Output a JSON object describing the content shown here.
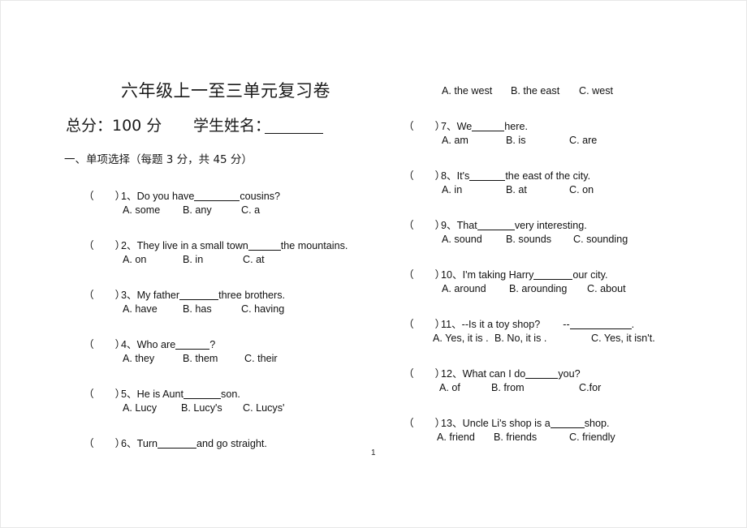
{
  "document": {
    "title": "六年级上一至三单元复习卷",
    "total_score_label": "总分：100 分",
    "student_name_label": "学生姓名：",
    "section_heading": "一、单项选择（每题 3 分，共 45 分）",
    "page_number": "1",
    "open_paren": "（",
    "close_paren": "）"
  },
  "left_column": {
    "questions": [
      {
        "number": "1、",
        "text_before": "Do you have",
        "text_after": "cousins?",
        "options": [
          "A. some",
          "B. any",
          "C. a"
        ]
      },
      {
        "number": "2、",
        "text_before": "They live in a small town",
        "text_after": "the mountains.",
        "options": [
          "A. on",
          "B. in",
          "C. at"
        ]
      },
      {
        "number": "3、",
        "text_before": "My father",
        "text_after": "three brothers.",
        "options": [
          "A. have",
          "B. has",
          "C. having"
        ]
      },
      {
        "number": "4、",
        "text_before": "Who are",
        "text_after": "?",
        "options": [
          "A. they",
          "B. them",
          "C. their"
        ]
      },
      {
        "number": "5、",
        "text_before": "He is Aunt",
        "text_after": "son.",
        "options": [
          "A. Lucy",
          "B. Lucy's",
          "C. Lucys'"
        ]
      },
      {
        "number": "6、",
        "text_before": "Turn",
        "text_after": "and go straight.",
        "options": []
      }
    ]
  },
  "right_column": {
    "orphan_options": [
      "A. the west",
      "B. the east",
      "C. west"
    ],
    "questions": [
      {
        "number": "7、",
        "text_before": "We",
        "text_after": "here.",
        "options": [
          "A. am",
          "B. is",
          "C. are"
        ]
      },
      {
        "number": "8、",
        "text_before": "It's",
        "text_after": "the east of the city.",
        "options": [
          "A. in",
          "B. at",
          "C. on"
        ]
      },
      {
        "number": "9、",
        "text_before": "That",
        "text_after": "very interesting.",
        "options": [
          "A. sound",
          "B. sounds",
          "C. sounding"
        ]
      },
      {
        "number": "10、",
        "text_before": "I'm taking Harry",
        "text_after": "our city.",
        "options": [
          "A. around",
          "B. arounding",
          "C. about"
        ]
      },
      {
        "number": "11、",
        "text_before": "--Is it a toy shop?        --",
        "text_after": ".",
        "options": [
          "A. Yes, it is .",
          "B. No, it is .",
          "C. Yes, it isn't."
        ]
      },
      {
        "number": "12、",
        "text_before": "What can I do",
        "text_after": "you?",
        "options": [
          "A. of",
          "B. from",
          "C.for"
        ]
      },
      {
        "number": "13、",
        "text_before": "Uncle Li's shop is a",
        "text_after": "shop.",
        "options": [
          "A. friend",
          "B. friends",
          "C. friendly"
        ]
      }
    ]
  }
}
